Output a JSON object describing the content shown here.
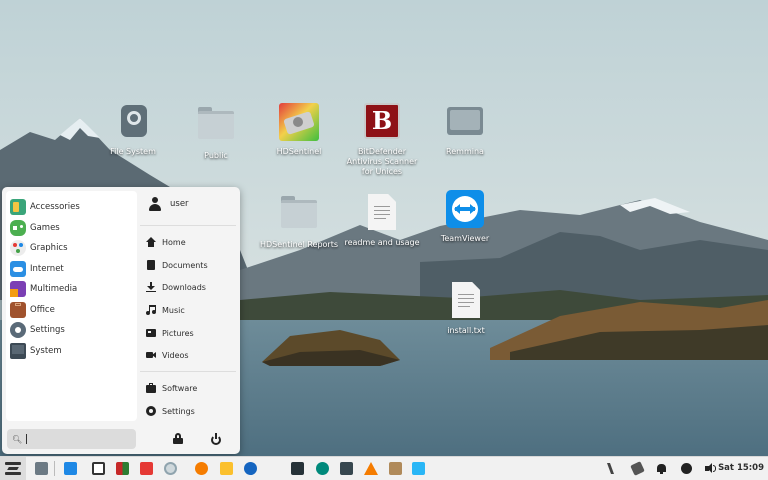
{
  "desktop": {
    "icons": [
      {
        "label": "File System",
        "icon": "drive-icon"
      },
      {
        "label": "Public",
        "icon": "folder-icon"
      },
      {
        "label": "HDSentinel",
        "icon": "hdsentinel-icon"
      },
      {
        "label": "BitDefender Antivirus Scanner for Unices",
        "icon": "bitdefender-icon"
      },
      {
        "label": "Remmina",
        "icon": "remmina-icon"
      },
      {
        "label": "HDSentinel Reports",
        "icon": "folder-icon"
      },
      {
        "label": "readme and usage",
        "icon": "text-file-icon"
      },
      {
        "label": "TeamViewer",
        "icon": "teamviewer-icon"
      },
      {
        "label": "install.txt",
        "icon": "text-file-icon"
      }
    ]
  },
  "menu": {
    "categories": [
      {
        "label": "Accessories",
        "icon": "accessories-icon",
        "color": "#3aa57a"
      },
      {
        "label": "Games",
        "icon": "games-icon",
        "color": "#4caf50"
      },
      {
        "label": "Graphics",
        "icon": "graphics-icon",
        "color": "#e0e0e0"
      },
      {
        "label": "Internet",
        "icon": "internet-icon",
        "color": "#2b8fe3"
      },
      {
        "label": "Multimedia",
        "icon": "multimedia-icon",
        "color": "#7b3fb4"
      },
      {
        "label": "Office",
        "icon": "office-icon",
        "color": "#a0522d"
      },
      {
        "label": "Settings",
        "icon": "settings-icon",
        "color": "#5a6a78"
      },
      {
        "label": "System",
        "icon": "system-icon",
        "color": "#3d4a55"
      }
    ],
    "search": {
      "value": ""
    },
    "user": {
      "label": "user"
    },
    "places": [
      {
        "label": "Home",
        "icon": "home-icon"
      },
      {
        "label": "Documents",
        "icon": "documents-icon"
      },
      {
        "label": "Downloads",
        "icon": "downloads-icon"
      },
      {
        "label": "Music",
        "icon": "music-icon"
      },
      {
        "label": "Pictures",
        "icon": "pictures-icon"
      },
      {
        "label": "Videos",
        "icon": "videos-icon"
      }
    ],
    "system": [
      {
        "label": "Software",
        "icon": "software-icon"
      },
      {
        "label": "Settings",
        "icon": "settings-gear-icon"
      }
    ]
  },
  "taskbar": {
    "clock": "Sat 15:09",
    "apps": [
      "zorin-menu-icon",
      "workspace-icon",
      "desktop-icon",
      "files-icon",
      "app-grid-icon",
      "pen-icon",
      "chrome-icon",
      "firefox-icon",
      "mail-icon",
      "edge-icon",
      "terminal-icon",
      "remote-icon",
      "app-icon",
      "vlc-icon",
      "archive-icon",
      "store-icon"
    ],
    "tray": [
      "zorin-connect-icon",
      "network-icon",
      "notifications-icon",
      "update-icon",
      "volume-icon"
    ]
  }
}
